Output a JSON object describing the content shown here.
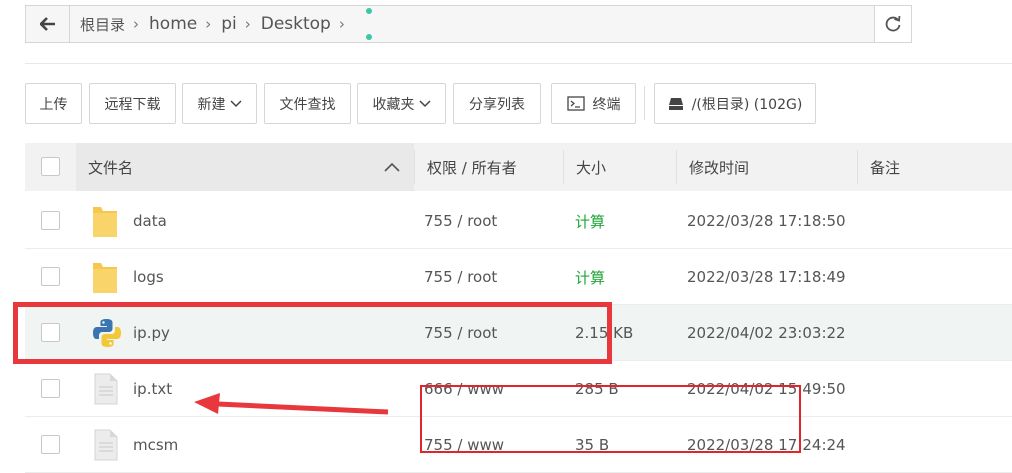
{
  "breadcrumb": {
    "items": [
      "根目录",
      "home",
      "pi",
      "Desktop"
    ]
  },
  "toolbar": {
    "upload": "上传",
    "remote_download": "远程下载",
    "new": "新建",
    "file_search": "文件查找",
    "favorites": "收藏夹",
    "share_list": "分享列表",
    "terminal": "终端",
    "disk": "/(根目录) (102G)"
  },
  "table": {
    "headers": {
      "name": "文件名",
      "perm": "权限 / 所有者",
      "size": "大小",
      "mtime": "修改时间",
      "note": "备注"
    },
    "rows": [
      {
        "name": "data",
        "type": "folder",
        "perm": "755 / root",
        "size": "计算",
        "mtime": "2022/03/28 17:18:50"
      },
      {
        "name": "logs",
        "type": "folder",
        "perm": "755 / root",
        "size": "计算",
        "mtime": "2022/03/28 17:18:49"
      },
      {
        "name": "ip.py",
        "type": "python",
        "perm": "755 / root",
        "size": "2.15 KB",
        "mtime": "2022/04/02 23:03:22"
      },
      {
        "name": "ip.txt",
        "type": "text",
        "perm": "666 / www",
        "size": "285 B",
        "mtime": "2022/04/02 15:49:50"
      },
      {
        "name": "mcsm",
        "type": "text",
        "perm": "755 / www",
        "size": "35 B",
        "mtime": "2022/03/28 17:24:24"
      }
    ]
  },
  "colors": {
    "calc_green": "#20a53a",
    "annotation_red": "#e8383d",
    "folder_yellow": "#f5c74c"
  }
}
